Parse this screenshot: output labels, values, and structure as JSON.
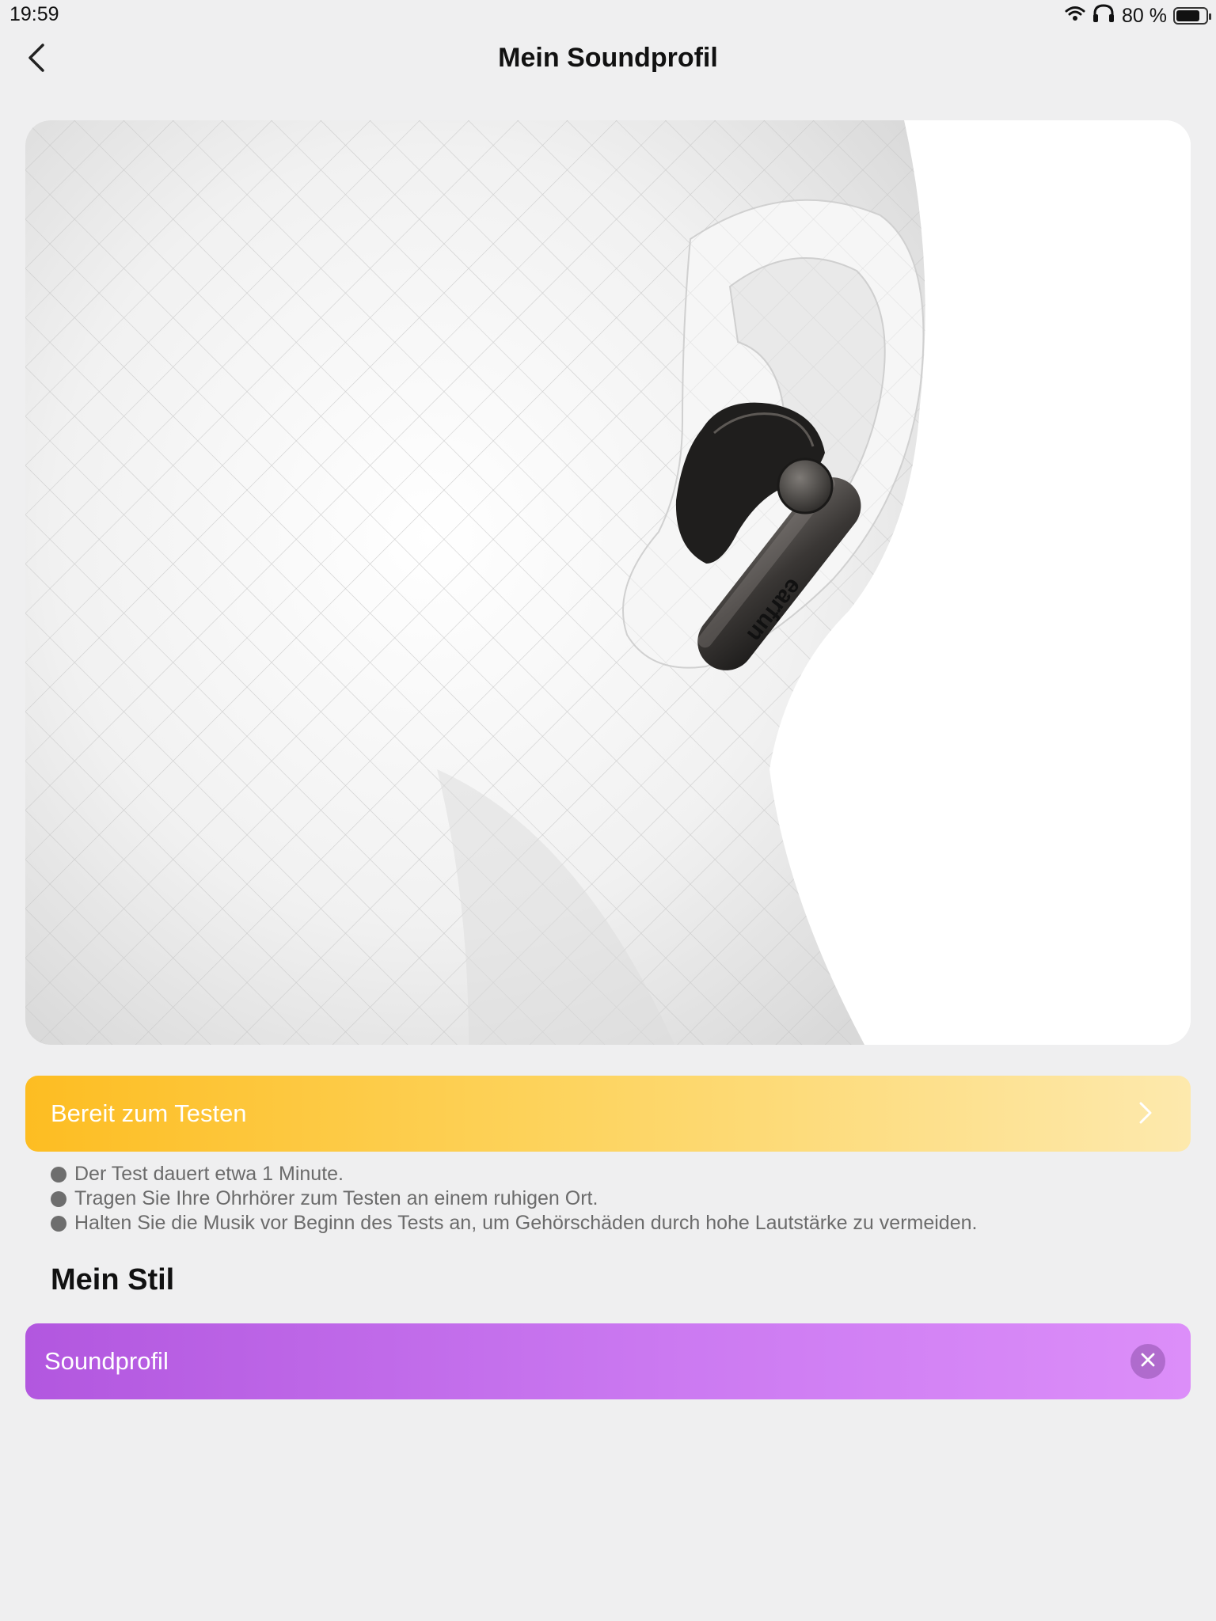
{
  "status_bar": {
    "time": "19:59",
    "battery_text": "80 %",
    "battery_level": 0.8,
    "icons": [
      "wifi-icon",
      "headphones-icon",
      "battery-icon"
    ]
  },
  "nav": {
    "title": "Mein Soundprofil",
    "back_icon": "chevron-left-icon"
  },
  "hero": {
    "image": "earbud-in-ear-render",
    "brand_text": "earfun"
  },
  "test_button": {
    "label": "Bereit zum Testen",
    "icon": "chevron-right-icon",
    "colors": [
      "#fdbd22",
      "#fde9ad"
    ]
  },
  "tips": [
    "Der Test dauert etwa 1 Minute.",
    "Tragen Sie Ihre Ohrhörer zum Testen an einem ruhigen Ort.",
    "Halten Sie die Musik vor Beginn des Tests an, um Gehörschäden durch hohe Lautstärke zu vermeiden."
  ],
  "section": {
    "title": "Mein Stil"
  },
  "profile_card": {
    "label": "Soundprofil",
    "icon": "close-icon",
    "colors": [
      "#b257df",
      "#dc8ef9"
    ]
  }
}
